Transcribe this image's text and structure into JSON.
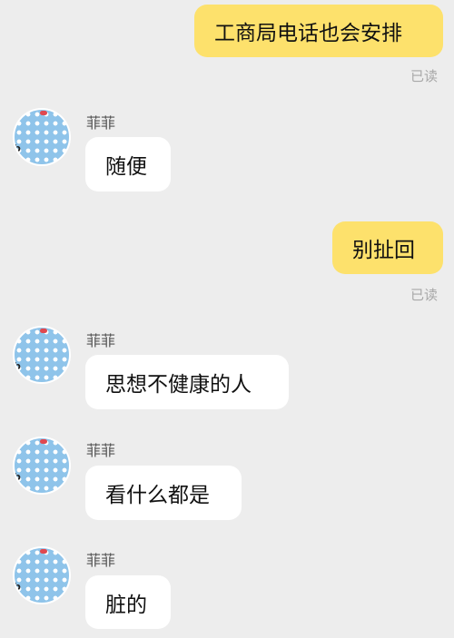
{
  "contact": {
    "name": "菲菲"
  },
  "messages": [
    {
      "side": "out",
      "text": "工商局电话也会安排",
      "status": "已读"
    },
    {
      "side": "in",
      "sender": "菲菲",
      "text": "随便"
    },
    {
      "side": "out",
      "text": "别扯回",
      "status": "已读"
    },
    {
      "side": "in",
      "sender": "菲菲",
      "text": "思想不健康的人"
    },
    {
      "side": "in",
      "sender": "菲菲",
      "text": "看什么都是"
    },
    {
      "side": "in",
      "sender": "菲菲",
      "text": "脏的"
    }
  ],
  "colors": {
    "background": "#ededed",
    "outgoing_bubble": "#fde16c",
    "incoming_bubble": "#ffffff",
    "avatar": "#8fc4ea"
  }
}
